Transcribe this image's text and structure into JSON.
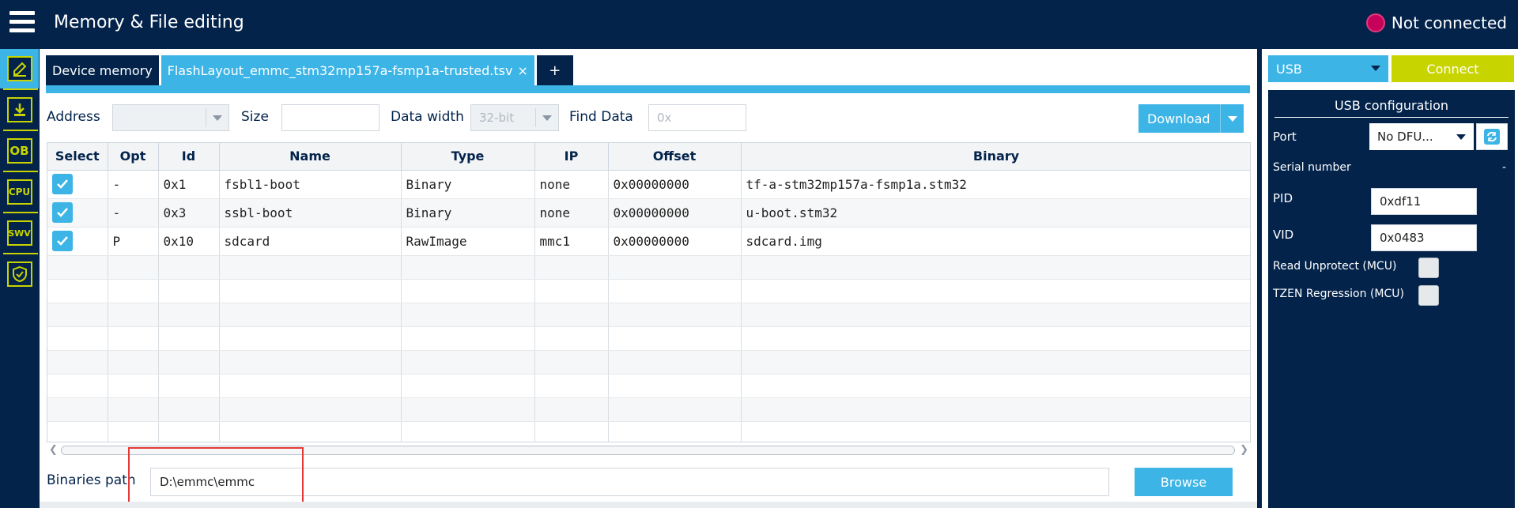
{
  "header": {
    "title": "Memory & File editing",
    "connection_status": "Not connected",
    "status_color": "#c6005b"
  },
  "sidebar": {
    "items": [
      {
        "name": "memory-edit-icon",
        "label": ""
      },
      {
        "name": "download-icon",
        "label": ""
      },
      {
        "name": "option-bytes-icon",
        "label": "OB"
      },
      {
        "name": "cpu-icon",
        "label": "CPU"
      },
      {
        "name": "swv-icon",
        "label": "SWV"
      },
      {
        "name": "security-shield-icon",
        "label": ""
      }
    ]
  },
  "tabs": {
    "device_memory": "Device memory",
    "flashlayout": "FlashLayout_emmc_stm32mp157a-fsmp1a-trusted.tsv",
    "close": "×",
    "add": "+"
  },
  "toolbar": {
    "address_label": "Address",
    "size_label": "Size",
    "data_width_label": "Data width",
    "data_width_value": "32-bit",
    "find_data_label": "Find Data",
    "find_data_placeholder": "0x",
    "download_label": "Download"
  },
  "table": {
    "columns": [
      "Select",
      "Opt",
      "Id",
      "Name",
      "Type",
      "IP",
      "Offset",
      "Binary"
    ],
    "rows": [
      {
        "select": true,
        "opt": "-",
        "id": "0x1",
        "name": "fsbl1-boot",
        "type": "Binary",
        "ip": "none",
        "offset": "0x00000000",
        "binary": "tf-a-stm32mp157a-fsmp1a.stm32"
      },
      {
        "select": true,
        "opt": "-",
        "id": "0x3",
        "name": "ssbl-boot",
        "type": "Binary",
        "ip": "none",
        "offset": "0x00000000",
        "binary": "u-boot.stm32"
      },
      {
        "select": true,
        "opt": "P",
        "id": "0x10",
        "name": "sdcard",
        "type": "RawImage",
        "ip": "mmc1",
        "offset": "0x00000000",
        "binary": "sdcard.img"
      }
    ]
  },
  "binaries": {
    "label": "Binaries path",
    "path": "D:\\emmc\\emmc",
    "browse_label": "Browse"
  },
  "connection": {
    "interface": "USB",
    "connect_label": "Connect",
    "config_title": "USB configuration",
    "port_label": "Port",
    "port_value": "No DFU...",
    "serial_label": "Serial number",
    "serial_value": "-",
    "pid_label": "PID",
    "pid_value": "0xdf11",
    "vid_label": "VID",
    "vid_value": "0x0483",
    "read_unprotect_label": "Read Unprotect (MCU)",
    "tzen_label": "TZEN Regression (MCU)"
  }
}
